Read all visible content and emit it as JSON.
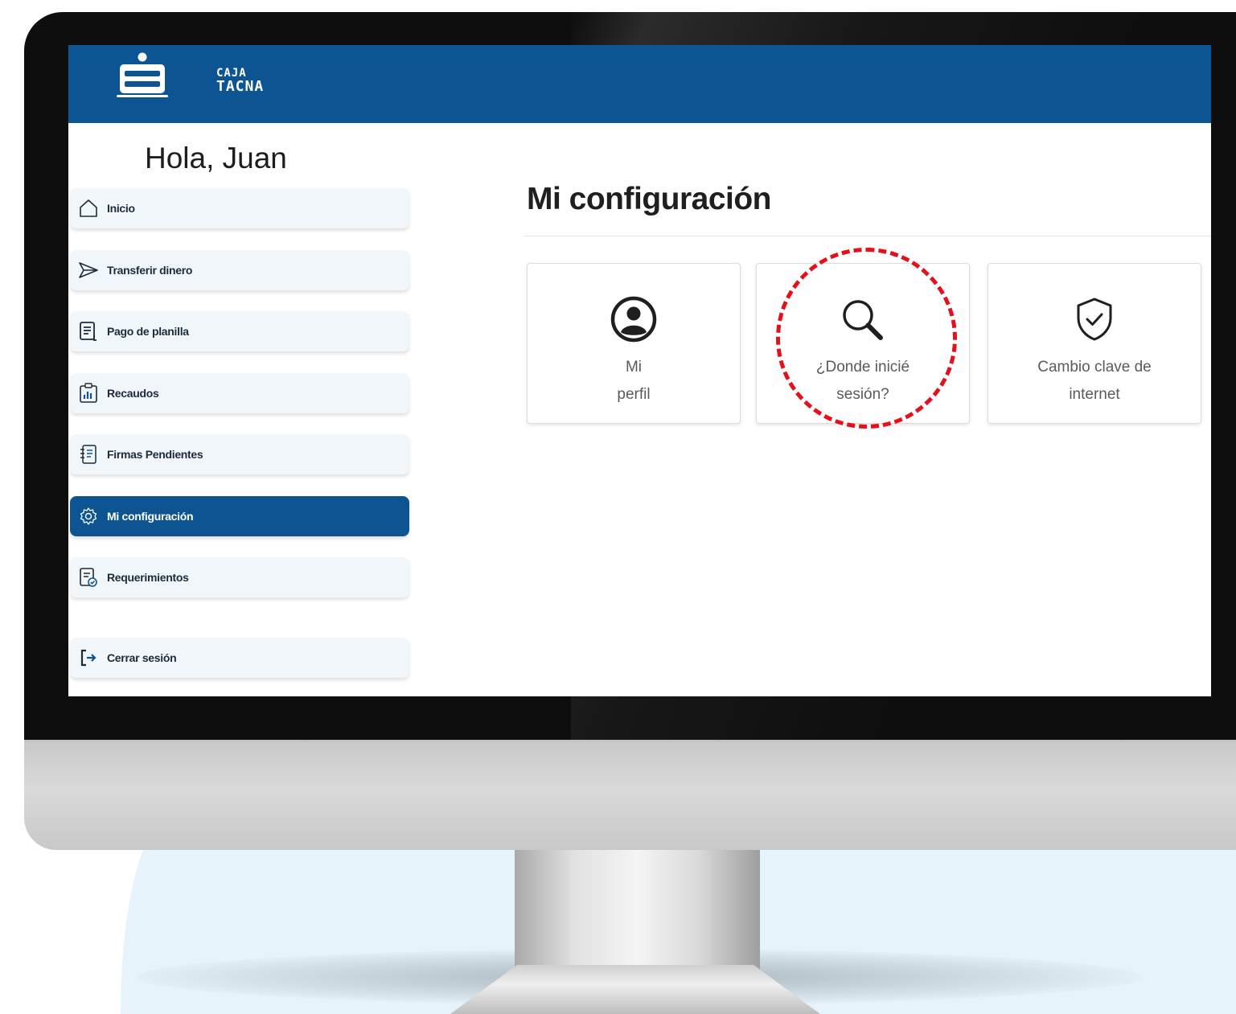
{
  "brand": {
    "line1": "CAJA",
    "line2": "TACNA"
  },
  "greeting": "Hola, Juan",
  "sidebar": {
    "items": [
      {
        "label": "Inicio",
        "icon": "home-icon"
      },
      {
        "label": "Transferir dinero",
        "icon": "send-icon"
      },
      {
        "label": "Pago de planilla",
        "icon": "document-icon"
      },
      {
        "label": "Recaudos",
        "icon": "clipboard-chart-icon"
      },
      {
        "label": "Firmas Pendientes",
        "icon": "notebook-icon"
      },
      {
        "label": "Mi configuración",
        "icon": "gear-icon",
        "active": true
      },
      {
        "label": "Requerimientos",
        "icon": "document-check-icon"
      }
    ],
    "logout": {
      "label": "Cerrar sesión",
      "icon": "logout-icon"
    }
  },
  "main": {
    "title": "Mi configuración",
    "cards": [
      {
        "line1": "Mi",
        "line2": "perfil",
        "icon": "user-circle-icon"
      },
      {
        "line1": "¿Donde inicié",
        "line2": "sesión?",
        "icon": "search-icon"
      },
      {
        "line1": "Cambio clave de",
        "line2": "internet",
        "icon": "shield-check-icon"
      }
    ]
  },
  "colors": {
    "brand_blue": "#0c5592",
    "highlight_red": "#e4101b"
  }
}
